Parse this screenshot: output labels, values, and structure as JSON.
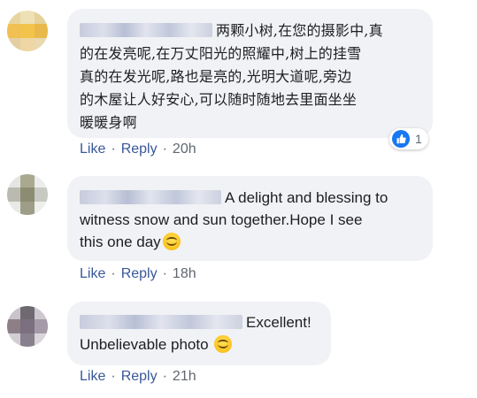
{
  "comments": [
    {
      "text_lines": [
        "两颗小树,在您的摄影中,真",
        "的在发亮呢,在万丈阳光的照耀中,树上的挂雪",
        "真的在发光呢,路也是亮的,光明大道呢,旁边",
        "的木屋让人好安心,可以随时随地去里面坐坐",
        "暖暖身啊"
      ],
      "like_label": "Like",
      "reply_label": "Reply",
      "separator": "·",
      "time": "20h",
      "reaction_count": "1",
      "reaction_icon": "thumbs-up-icon",
      "avatar_colors": [
        "#e8d59e",
        "#efe1b6",
        "#e4d29a",
        "#f0c152",
        "#f3c34c",
        "#e8b94a",
        "#e3cfa3",
        "#eed7a4",
        "#e9d8b0"
      ]
    },
    {
      "text_line1": "A delight and blessing to",
      "text_line2": "witness snow and sun together.Hope I see",
      "text_line3": "this one day",
      "emoji": "smiling-face-emoji",
      "like_label": "Like",
      "reply_label": "Reply",
      "separator": "·",
      "time": "18h",
      "avatar_colors": [
        "#e5e5e3",
        "#a9a98f",
        "#ececea",
        "#bbbab0",
        "#8c8c72",
        "#c9c9c4",
        "#e9e9e7",
        "#9e9e88",
        "#efefed"
      ]
    },
    {
      "text_line1": "Excellent!",
      "text_line2": "Unbelievable photo",
      "emoji": "smiling-face-emoji",
      "like_label": "Like",
      "reply_label": "Reply",
      "separator": "·",
      "time": "21h",
      "avatar_colors": [
        "#c9c4ca",
        "#6f6a72",
        "#cdc8cf",
        "#8e7f86",
        "#7b6f80",
        "#a59aa7",
        "#d3ced4",
        "#88808c",
        "#d9d5da"
      ]
    }
  ],
  "colors": {
    "bubble": "#f0f2f5",
    "link": "#385898",
    "meta": "#606770",
    "like_badge": "#1877f2"
  }
}
